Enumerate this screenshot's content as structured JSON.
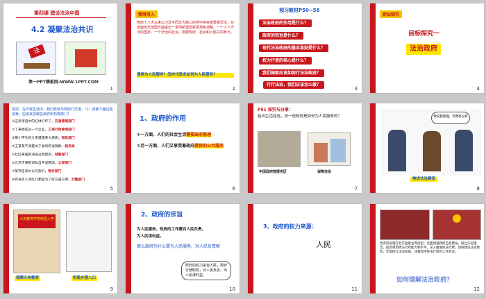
{
  "slides": [
    {
      "n": "1",
      "lesson": "第四课 建设法治中国",
      "title": "4.2 凝聚法治共识",
      "footer": "第一PPT模板网-WWW.1PPT.COM",
      "law_label": "法"
    },
    {
      "n": "2",
      "tag": "情境导入",
      "body": "党的十八大以来以习近平同志为核心的党中央高度重视法治，在全面依法治国方面提出一系列新理念新思想新战略。一个人人守法的国家，一个法治的社会，需要政府、社会和公民共同参与。",
      "question": "通常为人民服务？怎样代表求如何为人民服务？"
    },
    {
      "n": "3",
      "header": "预习教材P50--56",
      "items": [
        "法治政府的作用是什么？",
        "政府的宗旨是什么？",
        "现代法治政府的基本准则是什么？",
        "权力行使的核心是什么？",
        "我们国家应该如何行法治政府？",
        "行行法治，我们应该怎么做？"
      ]
    },
    {
      "n": "4",
      "tag": "新知探究",
      "target": "目标探究一",
      "topic": "法治政府"
    },
    {
      "n": "5",
      "intro": "探究：在日常生活中，我们经常与政府打交道。（1）搜索下面这些情景，应该来找哪些政府机构等部门？",
      "rows": [
        {
          "q": "①这条街道中的红绿灯坏了，",
          "a": "交通管理部门"
        },
        {
          "q": "②丁某想成立一个企业，",
          "a": "工商行政管理部门"
        },
        {
          "q": "③某小学生的父亲遭遇重大疾病，",
          "a": "民政部门"
        },
        {
          "q": "④王某某不清楚关于收到的退税款，",
          "a": "税务局"
        },
        {
          "q": "⑤社区某居民违规占地建房，",
          "a": "城管部门"
        },
        {
          "q": "⑥北京市某街道私自开设赌场，",
          "a": "公安部门"
        },
        {
          "q": "⑦某市自来水公司涨价，",
          "a": "物价部门"
        },
        {
          "q": "⑧有很多人闯红灯都是为了好交通方便，",
          "a": "交警部门"
        }
      ]
    },
    {
      "n": "6",
      "heading": "1、政府的作用",
      "line1_prefix": "①一方面，人们的社会生活",
      "line1_hl": "需要政府管理",
      "line2_prefix": "②另一方面，人们又享受着政府",
      "line2_hl": "提供的公共服务"
    },
    {
      "n": "7",
      "header": "P51 探究与分享：",
      "body": "结合生活经验，说一说政府是如何为人民服务的？",
      "cap1": "中国政府救援灾区",
      "cap2": "保障住房"
    },
    {
      "n": "8",
      "bubble": "你说我管理，行政有没有",
      "caption": "推进法治建设"
    },
    {
      "n": "9",
      "sign": "义务教育学校统招入学",
      "cap1": "保障义务教育",
      "cap2": "积极办理入口"
    },
    {
      "n": "10",
      "heading": "2、政府的宗旨",
      "line1": "为人民服务，政府的工作要对人民负责，",
      "line2": "为人民谋利益。",
      "question": "那么政府为什么要为人民服务、对人民负责呢",
      "note": "政府的权力来自人民，政府行使职权，对人民负责，为人民谋利益。"
    },
    {
      "n": "11",
      "heading": "3、政府的权力来源：",
      "answer": "人民"
    },
    {
      "n": "12",
      "body": "党务院总理在北京国家主席指出：全面加强政府自身建设，树立法治理念，提高政府依法行政能力和水平，深入推进依法行政，加快建设法治政府，牢固树立法治权威，注重程序依法行政的工作状况。",
      "question": "如何理解法治政府？"
    }
  ]
}
